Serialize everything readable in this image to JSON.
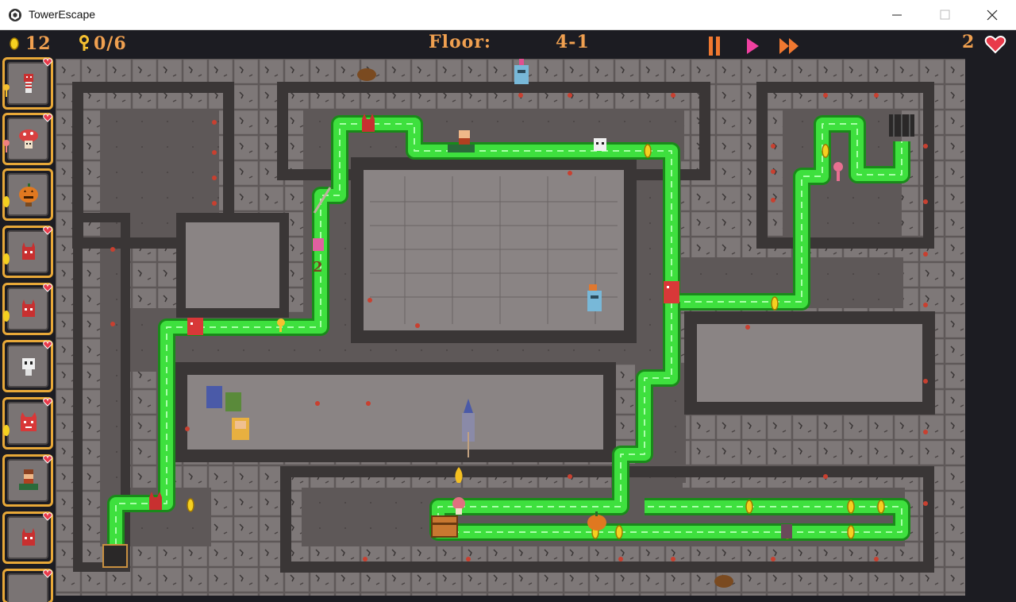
{
  "window": {
    "title": "TowerEscape"
  },
  "hud": {
    "coins": "12",
    "keys": "0/6",
    "floor_label": "Floor:",
    "floor_value": "4-1",
    "lives": "2"
  },
  "map": {
    "floating_number": "2"
  },
  "sidebar": {
    "cards": [
      {
        "icon": "red-imp-character",
        "tag": "key-tag-icon"
      },
      {
        "icon": "mushroom-character",
        "tag": "key-tag-icon"
      },
      {
        "icon": "pumpkin-character",
        "tag": "coin-tag-icon"
      },
      {
        "icon": "red-devil-character",
        "tag": "coin-tag-icon"
      },
      {
        "icon": "red-devil-character",
        "tag": "coin-tag-icon"
      },
      {
        "icon": "skull-character",
        "tag": ""
      },
      {
        "icon": "red-dragon-character",
        "tag": "coin-tag-icon"
      },
      {
        "icon": "bearded-warrior-character",
        "tag": ""
      },
      {
        "icon": "red-devil-character",
        "tag": ""
      },
      {
        "icon": "empty-slot",
        "tag": ""
      }
    ]
  },
  "colors": {
    "hud_text": "#f0a050",
    "path_green": "#3ee03e",
    "card_border": "#e8a838",
    "heart": "#e83a4a",
    "floor_tile": "#7e7878",
    "wall_dark": "#3a3636"
  }
}
